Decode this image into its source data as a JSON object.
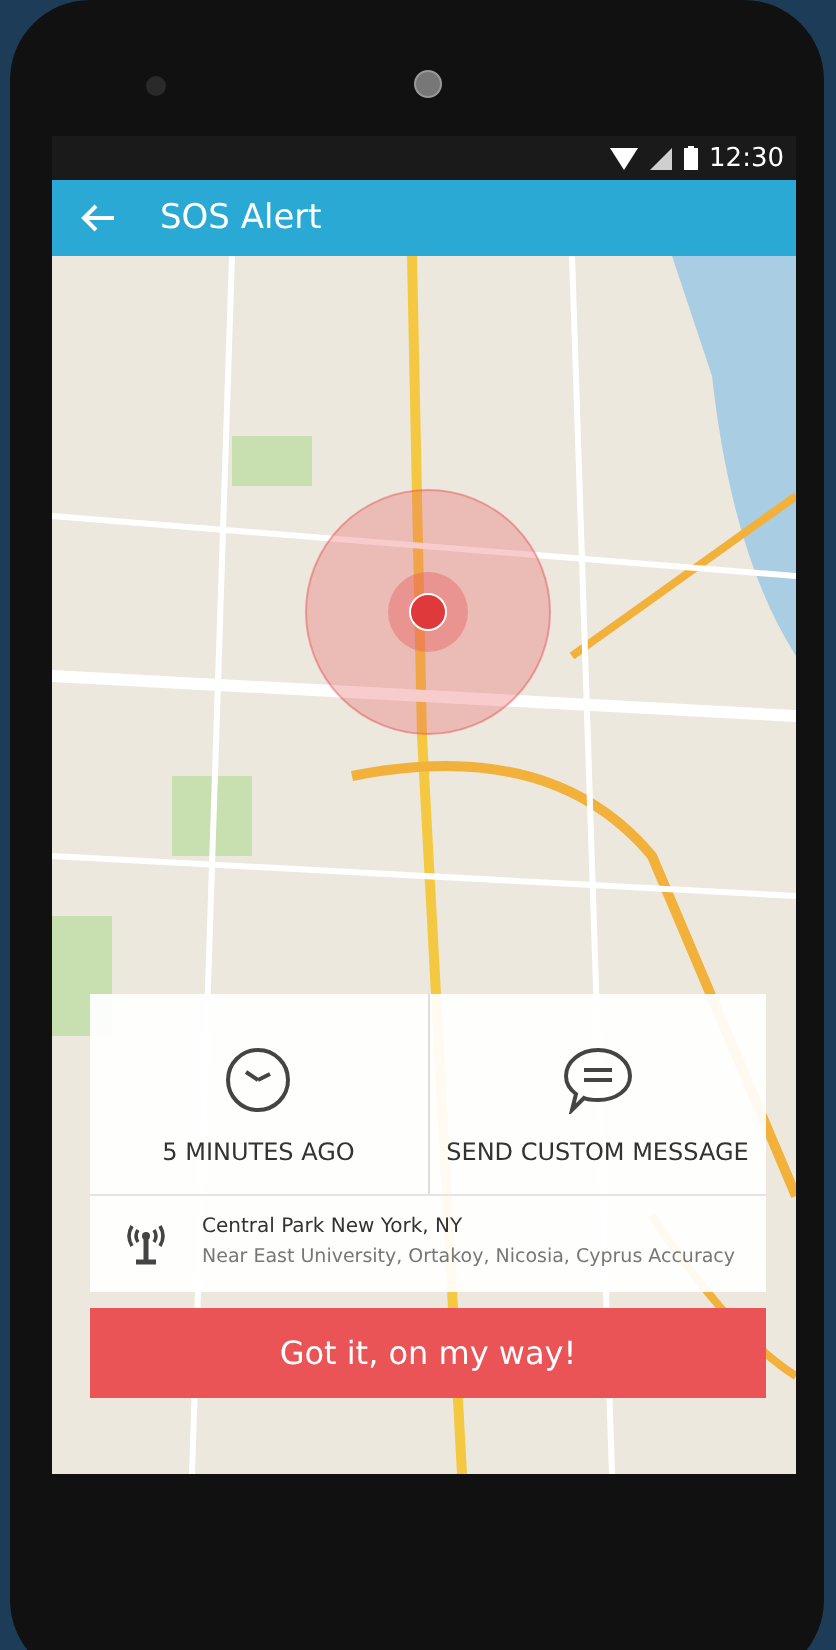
{
  "status_bar": {
    "time": "12:30"
  },
  "app_bar": {
    "title": "SOS Alert"
  },
  "alert_card": {
    "actions": [
      {
        "kind": "clock",
        "label": "5 MINUTES AGO"
      },
      {
        "kind": "message",
        "label": "SEND CUSTOM MESSAGE"
      }
    ],
    "location": {
      "title": "Central Park New York, NY",
      "detail": "Near East University, Ortakoy, Nicosia, Cyprus Accuracy"
    }
  },
  "primary_button": {
    "label": "Got it, on my way!"
  }
}
